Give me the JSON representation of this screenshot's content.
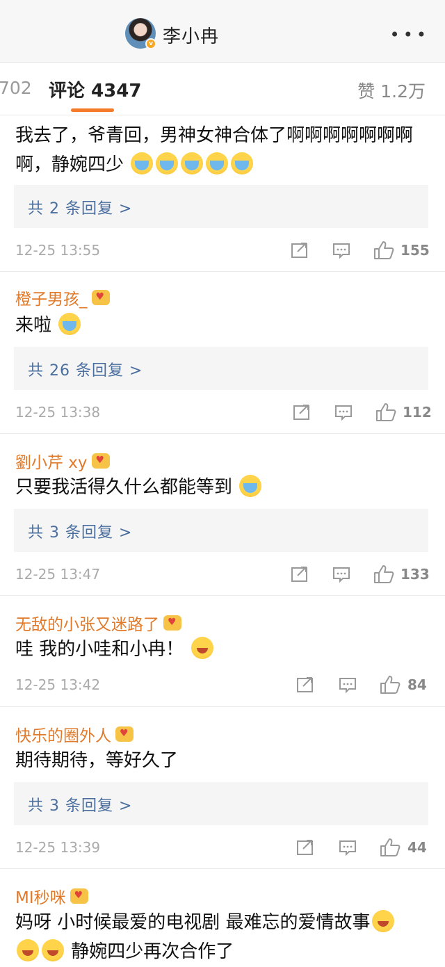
{
  "header": {
    "title": "李小冉",
    "more_label": "•••"
  },
  "tabs": {
    "left_partial": "702",
    "active": "评论 4347",
    "right": "赞 1.2万"
  },
  "comments": [
    {
      "username": "",
      "text": "我去了，爷青回，男神女神合体了啊啊啊啊啊啊啊啊，静婉四少",
      "emojis": 5,
      "reply": "共 2 条回复 >",
      "time": "12-25 13:55",
      "likes": "155"
    },
    {
      "username": "橙子男孩_",
      "text": "来啦",
      "emojis": 1,
      "reply": "共 26 条回复 >",
      "time": "12-25 13:38",
      "likes": "112"
    },
    {
      "username": "劉小芹 xy",
      "text": "只要我活得久什么都能等到",
      "emojis": 1,
      "reply": "共 3 条回复 >",
      "time": "12-25 13:47",
      "likes": "133"
    },
    {
      "username": "无敌的小张又迷路了",
      "text": "哇 我的小哇和小冉！",
      "emojis": 1,
      "reply": "",
      "time": "12-25 13:42",
      "likes": "84"
    },
    {
      "username": "快乐的圈外人",
      "text": "期待期待，等好久了",
      "emojis": 0,
      "reply": "共 3 条回复 >",
      "time": "12-25 13:39",
      "likes": "44"
    },
    {
      "username": "MI秒咪",
      "text_line1": "妈呀 小时候最爱的电视剧 最难忘的爱情故事",
      "text_line2": "静婉四少再次合作了",
      "emojis": 3
    }
  ]
}
